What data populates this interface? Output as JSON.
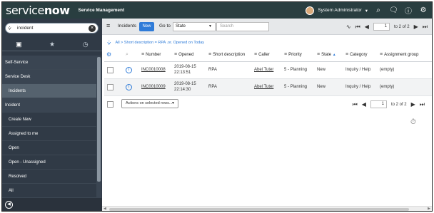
{
  "banner": {
    "logo_prefix": "service",
    "logo_suffix": "now",
    "product": "Service Management",
    "user": "System Administrator",
    "user_caret": "▾",
    "icons": [
      "search-icon",
      "chat-icon",
      "help-icon",
      "gear-icon"
    ]
  },
  "sidebar": {
    "filter_value": "incident",
    "tabs": [
      "all-apps-icon",
      "favorites-star-icon",
      "history-clock-icon"
    ],
    "items": [
      {
        "label": "Self-Service",
        "type": "section"
      },
      {
        "label": "Service Desk",
        "type": "section"
      },
      {
        "label": "Incidents",
        "type": "sub",
        "selected": true
      },
      {
        "label": "Incident",
        "type": "section"
      },
      {
        "label": "Create New",
        "type": "item"
      },
      {
        "label": "Assigned to me",
        "type": "item"
      },
      {
        "label": "Open",
        "type": "item"
      },
      {
        "label": "Open - Unassigned",
        "type": "item"
      },
      {
        "label": "Resolved",
        "type": "item"
      },
      {
        "label": "All",
        "type": "item"
      }
    ]
  },
  "list": {
    "title": "Incidents",
    "new_label": "New",
    "goto_label": "Go to",
    "goto_field": "State",
    "search_placeholder": "Search",
    "page_current": "1",
    "page_of": "to 2 of 2",
    "breadcrumb": "All > Short description = RPA .or. Opened on Today",
    "columns": [
      "Number",
      "Opened",
      "Short description",
      "Caller",
      "Priority",
      "State",
      "Category",
      "Assignment group"
    ],
    "sorted_column": "State",
    "rows": [
      {
        "number": "INC0010008",
        "opened_date": "2019-08-15",
        "opened_time": "22:13:51",
        "short_description": "RPA",
        "caller": "Abel Tuter",
        "priority": "5 - Planning",
        "state": "New",
        "category": "Inquiry / Help",
        "assignment_group": "(empty)"
      },
      {
        "number": "INC0010009",
        "opened_date": "2019-08-15",
        "opened_time": "22:14:30",
        "short_description": "RPA",
        "caller": "Abel Tuter",
        "priority": "5 - Planning",
        "state": "New",
        "category": "Inquiry / Help",
        "assignment_group": "(empty)"
      }
    ],
    "actions_label": "Actions on selected rows...",
    "bottom_page_current": "1",
    "bottom_page_of": "to 2 of 2"
  },
  "colors": {
    "banner": "#293e40",
    "sidebar": "#303a46",
    "accent": "#2e7bd8"
  }
}
